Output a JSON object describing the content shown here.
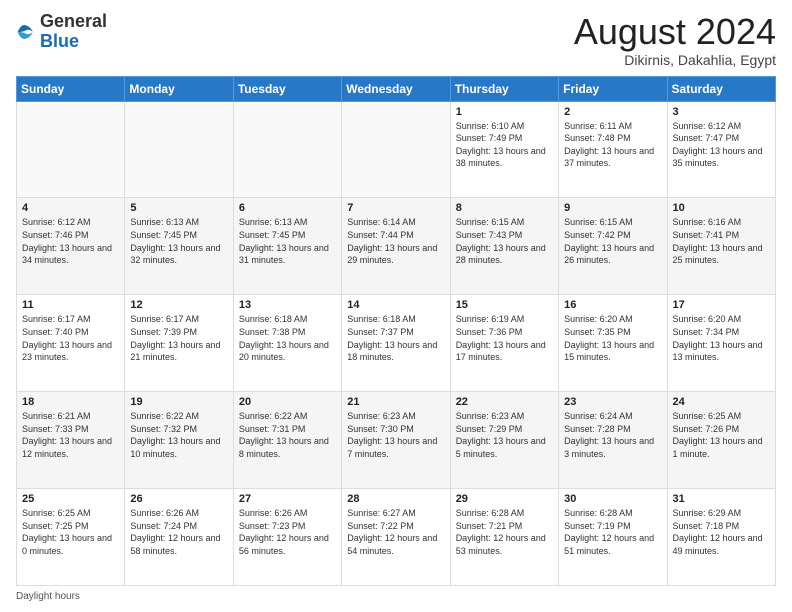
{
  "header": {
    "logo_general": "General",
    "logo_blue": "Blue",
    "main_title": "August 2024",
    "subtitle": "Dikirnis, Dakahlia, Egypt"
  },
  "days_of_week": [
    "Sunday",
    "Monday",
    "Tuesday",
    "Wednesday",
    "Thursday",
    "Friday",
    "Saturday"
  ],
  "weeks": [
    [
      {
        "day": "",
        "sunrise": "",
        "sunset": "",
        "daylight": ""
      },
      {
        "day": "",
        "sunrise": "",
        "sunset": "",
        "daylight": ""
      },
      {
        "day": "",
        "sunrise": "",
        "sunset": "",
        "daylight": ""
      },
      {
        "day": "",
        "sunrise": "",
        "sunset": "",
        "daylight": ""
      },
      {
        "day": "1",
        "sunrise": "6:10 AM",
        "sunset": "7:49 PM",
        "daylight": "13 hours and 38 minutes."
      },
      {
        "day": "2",
        "sunrise": "6:11 AM",
        "sunset": "7:48 PM",
        "daylight": "13 hours and 37 minutes."
      },
      {
        "day": "3",
        "sunrise": "6:12 AM",
        "sunset": "7:47 PM",
        "daylight": "13 hours and 35 minutes."
      }
    ],
    [
      {
        "day": "4",
        "sunrise": "6:12 AM",
        "sunset": "7:46 PM",
        "daylight": "13 hours and 34 minutes."
      },
      {
        "day": "5",
        "sunrise": "6:13 AM",
        "sunset": "7:45 PM",
        "daylight": "13 hours and 32 minutes."
      },
      {
        "day": "6",
        "sunrise": "6:13 AM",
        "sunset": "7:45 PM",
        "daylight": "13 hours and 31 minutes."
      },
      {
        "day": "7",
        "sunrise": "6:14 AM",
        "sunset": "7:44 PM",
        "daylight": "13 hours and 29 minutes."
      },
      {
        "day": "8",
        "sunrise": "6:15 AM",
        "sunset": "7:43 PM",
        "daylight": "13 hours and 28 minutes."
      },
      {
        "day": "9",
        "sunrise": "6:15 AM",
        "sunset": "7:42 PM",
        "daylight": "13 hours and 26 minutes."
      },
      {
        "day": "10",
        "sunrise": "6:16 AM",
        "sunset": "7:41 PM",
        "daylight": "13 hours and 25 minutes."
      }
    ],
    [
      {
        "day": "11",
        "sunrise": "6:17 AM",
        "sunset": "7:40 PM",
        "daylight": "13 hours and 23 minutes."
      },
      {
        "day": "12",
        "sunrise": "6:17 AM",
        "sunset": "7:39 PM",
        "daylight": "13 hours and 21 minutes."
      },
      {
        "day": "13",
        "sunrise": "6:18 AM",
        "sunset": "7:38 PM",
        "daylight": "13 hours and 20 minutes."
      },
      {
        "day": "14",
        "sunrise": "6:18 AM",
        "sunset": "7:37 PM",
        "daylight": "13 hours and 18 minutes."
      },
      {
        "day": "15",
        "sunrise": "6:19 AM",
        "sunset": "7:36 PM",
        "daylight": "13 hours and 17 minutes."
      },
      {
        "day": "16",
        "sunrise": "6:20 AM",
        "sunset": "7:35 PM",
        "daylight": "13 hours and 15 minutes."
      },
      {
        "day": "17",
        "sunrise": "6:20 AM",
        "sunset": "7:34 PM",
        "daylight": "13 hours and 13 minutes."
      }
    ],
    [
      {
        "day": "18",
        "sunrise": "6:21 AM",
        "sunset": "7:33 PM",
        "daylight": "13 hours and 12 minutes."
      },
      {
        "day": "19",
        "sunrise": "6:22 AM",
        "sunset": "7:32 PM",
        "daylight": "13 hours and 10 minutes."
      },
      {
        "day": "20",
        "sunrise": "6:22 AM",
        "sunset": "7:31 PM",
        "daylight": "13 hours and 8 minutes."
      },
      {
        "day": "21",
        "sunrise": "6:23 AM",
        "sunset": "7:30 PM",
        "daylight": "13 hours and 7 minutes."
      },
      {
        "day": "22",
        "sunrise": "6:23 AM",
        "sunset": "7:29 PM",
        "daylight": "13 hours and 5 minutes."
      },
      {
        "day": "23",
        "sunrise": "6:24 AM",
        "sunset": "7:28 PM",
        "daylight": "13 hours and 3 minutes."
      },
      {
        "day": "24",
        "sunrise": "6:25 AM",
        "sunset": "7:26 PM",
        "daylight": "13 hours and 1 minute."
      }
    ],
    [
      {
        "day": "25",
        "sunrise": "6:25 AM",
        "sunset": "7:25 PM",
        "daylight": "13 hours and 0 minutes."
      },
      {
        "day": "26",
        "sunrise": "6:26 AM",
        "sunset": "7:24 PM",
        "daylight": "12 hours and 58 minutes."
      },
      {
        "day": "27",
        "sunrise": "6:26 AM",
        "sunset": "7:23 PM",
        "daylight": "12 hours and 56 minutes."
      },
      {
        "day": "28",
        "sunrise": "6:27 AM",
        "sunset": "7:22 PM",
        "daylight": "12 hours and 54 minutes."
      },
      {
        "day": "29",
        "sunrise": "6:28 AM",
        "sunset": "7:21 PM",
        "daylight": "12 hours and 53 minutes."
      },
      {
        "day": "30",
        "sunrise": "6:28 AM",
        "sunset": "7:19 PM",
        "daylight": "12 hours and 51 minutes."
      },
      {
        "day": "31",
        "sunrise": "6:29 AM",
        "sunset": "7:18 PM",
        "daylight": "12 hours and 49 minutes."
      }
    ]
  ],
  "footer": {
    "daylight_label": "Daylight hours"
  }
}
